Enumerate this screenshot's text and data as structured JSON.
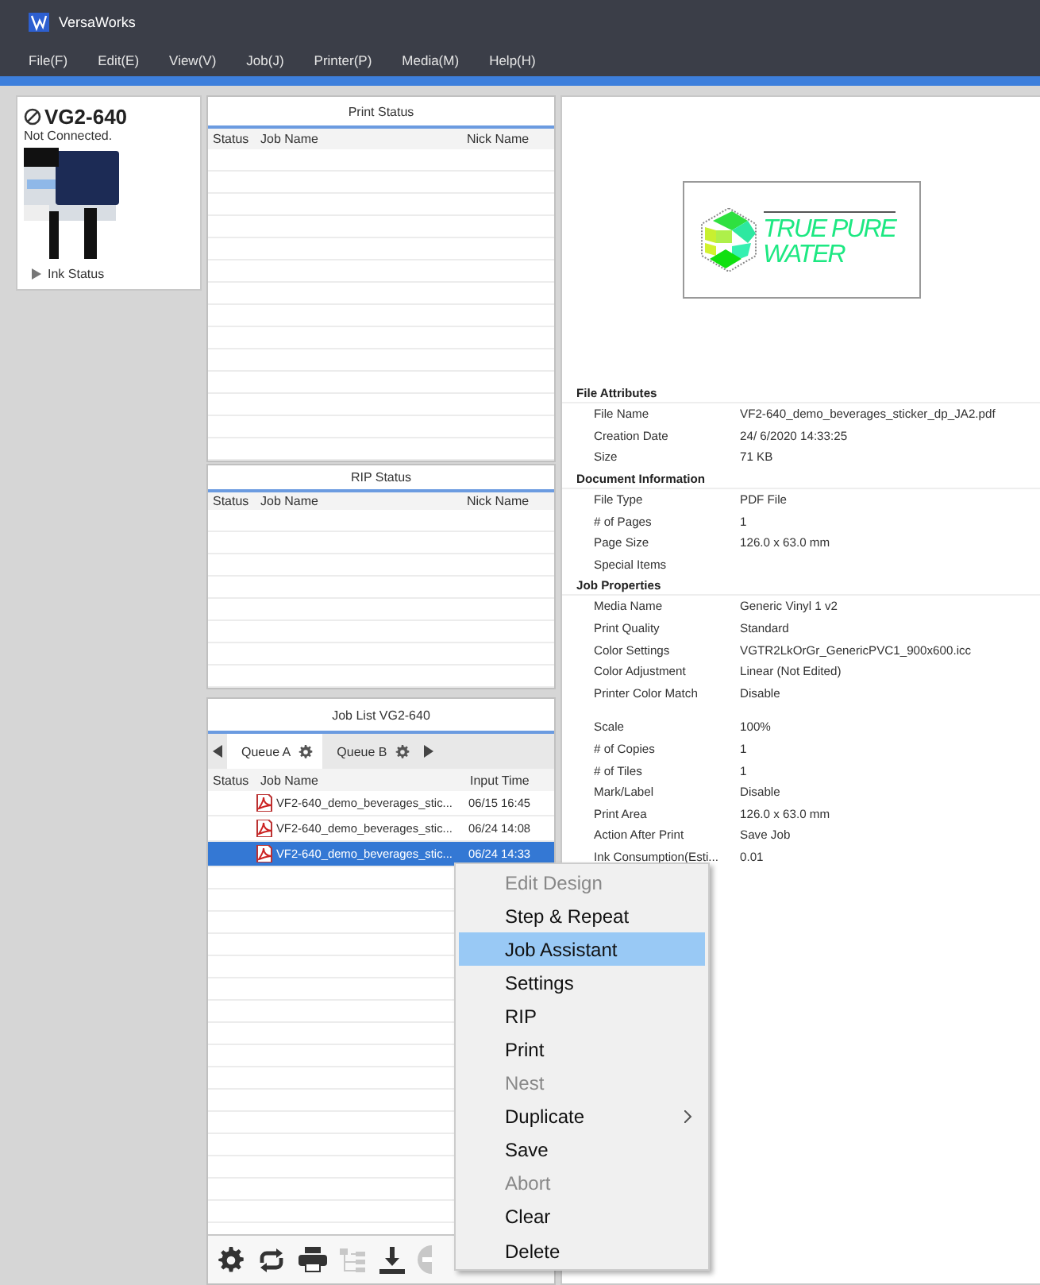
{
  "window": {
    "title": "VersaWorks"
  },
  "menu_bar": [
    "File(F)",
    "Edit(E)",
    "View(V)",
    "Job(J)",
    "Printer(P)",
    "Media(M)",
    "Help(H)"
  ],
  "printer": {
    "name": "VG2-640",
    "status": "Not Connected.",
    "ink_status": {
      "label": "Ink Status",
      "expanded": false
    }
  },
  "print_status": {
    "title": "Print Status",
    "columns": [
      "Status",
      "Job Name",
      "Nick Name"
    ]
  },
  "rip_status": {
    "title": "RIP Status",
    "columns": [
      "Status",
      "Job Name",
      "Nick Name"
    ]
  },
  "job_list": {
    "title": "Job List VG2-640",
    "tabs": [
      {
        "label": "Queue A",
        "selected": true
      },
      {
        "label": "Queue B",
        "selected": false
      }
    ],
    "columns": [
      "Status",
      "Job Name",
      "Input Time"
    ],
    "rows": [
      {
        "job_name": "VF2-640_demo_beverages_stic...",
        "input_time": "06/15 16:45",
        "selected": false
      },
      {
        "job_name": "VF2-640_demo_beverages_stic...",
        "input_time": "06/24 14:08",
        "selected": false
      },
      {
        "job_name": "VF2-640_demo_beverages_stic...",
        "input_time": "06/24 14:33",
        "selected": true
      }
    ],
    "toolbar": [
      {
        "kind": "gear",
        "disabled": false
      },
      {
        "kind": "refresh",
        "disabled": false
      },
      {
        "kind": "print",
        "disabled": false
      },
      {
        "kind": "tree",
        "disabled": true
      },
      {
        "kind": "download",
        "disabled": false
      },
      {
        "kind": "minus",
        "disabled": true
      }
    ]
  },
  "preview": {
    "logo_lines": [
      "TRUE PURE",
      "WATER"
    ]
  },
  "properties": [
    {
      "title": "File Attributes",
      "groups": [
        [
          [
            "File Name",
            "VF2-640_demo_beverages_sticker_dp_JA2.pdf"
          ],
          [
            "Creation Date",
            "24/ 6/2020 14:33:25"
          ],
          [
            "Size",
            "71 KB"
          ]
        ]
      ]
    },
    {
      "title": "Document Information",
      "groups": [
        [
          [
            "File Type",
            "PDF File"
          ],
          [
            "# of Pages",
            "1"
          ],
          [
            "Page Size",
            "126.0 x 63.0 mm"
          ],
          [
            "Special Items"
          ]
        ]
      ]
    },
    {
      "title": "Job Properties",
      "groups": [
        [
          [
            "Media Name",
            "Generic Vinyl 1 v2"
          ],
          [
            "Print Quality",
            "Standard"
          ],
          [
            "Color Settings",
            "VGTR2LkOrGr_GenericPVC1_900x600.icc"
          ],
          [
            "Color Adjustment",
            "Linear (Not Edited)"
          ],
          [
            "Printer Color Match",
            "Disable"
          ]
        ],
        [
          [
            "Scale",
            "100%"
          ],
          [
            "# of Copies",
            "1"
          ],
          [
            "# of Tiles",
            "1"
          ],
          [
            "Mark/Label",
            "Disable"
          ],
          [
            "Print Area",
            "126.0 x 63.0 mm"
          ],
          [
            "Action After Print",
            "Save Job"
          ],
          [
            "Ink Consumption(Esti...",
            "0.01"
          ]
        ]
      ]
    }
  ],
  "context_menu": [
    {
      "label": "Edit Design",
      "disabled": true,
      "selected": false,
      "submenu": false
    },
    {
      "label": "Step & Repeat",
      "disabled": false,
      "selected": false,
      "submenu": false
    },
    {
      "label": "Job Assistant",
      "disabled": false,
      "selected": true,
      "submenu": false
    },
    {
      "label": "Settings",
      "disabled": false,
      "selected": false,
      "submenu": false
    },
    {
      "label": "RIP",
      "disabled": false,
      "selected": false,
      "submenu": false
    },
    {
      "label": "Print",
      "disabled": false,
      "selected": false,
      "submenu": false
    },
    {
      "label": "Nest",
      "disabled": true,
      "selected": false,
      "submenu": false
    },
    {
      "label": "Duplicate",
      "disabled": false,
      "selected": false,
      "submenu": true
    },
    {
      "label": "Save",
      "disabled": false,
      "selected": false,
      "submenu": false
    },
    {
      "label": "Abort",
      "disabled": true,
      "selected": false,
      "submenu": false
    },
    {
      "label": "Clear",
      "disabled": false,
      "selected": false,
      "submenu": false
    },
    {
      "label": "Delete",
      "disabled": false,
      "selected": false,
      "submenu": false
    }
  ]
}
